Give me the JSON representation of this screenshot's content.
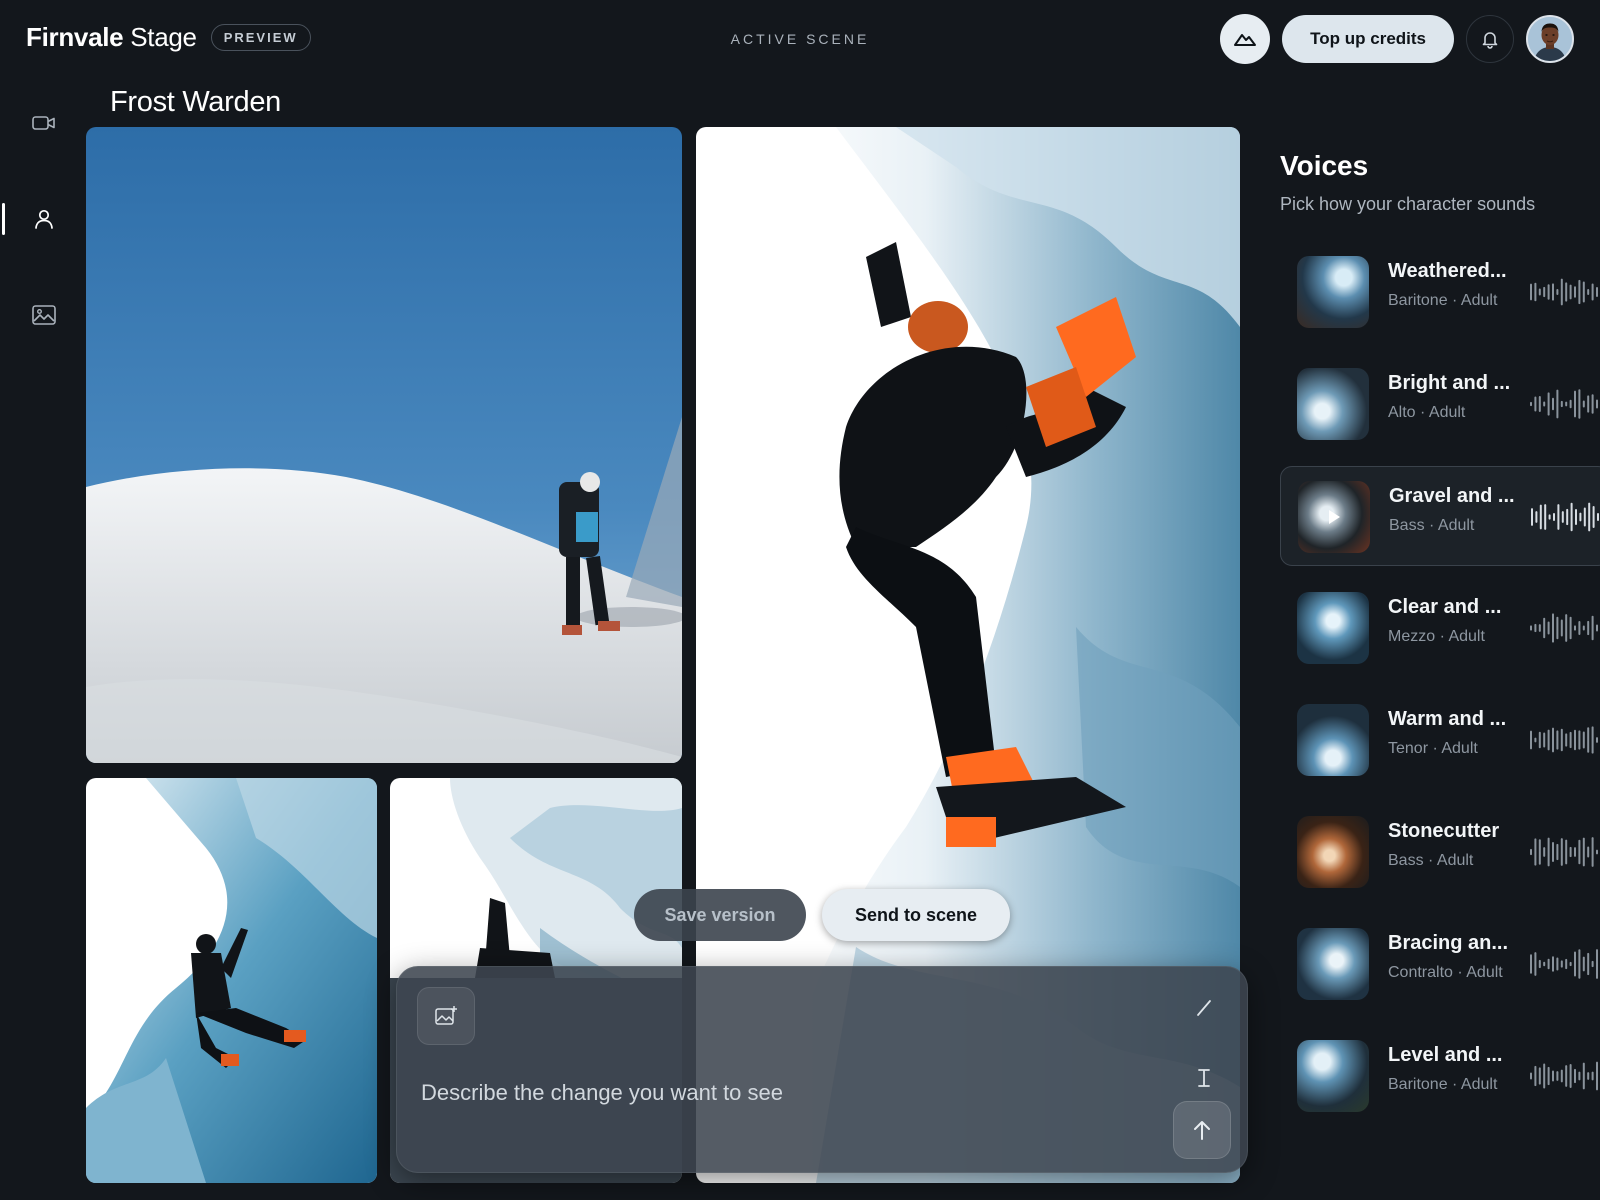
{
  "app": {
    "brand_bold": "Firnvale",
    "brand_light": "Stage",
    "preview_badge": "PREVIEW",
    "active_scene_label": "ACTIVE SCENE",
    "credits_button": "Top up credits"
  },
  "scene": {
    "title": "Frost Warden"
  },
  "actions": {
    "save_version": "Save version",
    "send_to_scene": "Send to scene"
  },
  "prompt": {
    "placeholder": "Describe the change you want to see"
  },
  "voices": {
    "title": "Voices",
    "subtitle": "Pick how your character sounds",
    "items": [
      {
        "name": "Weathered...",
        "meta": "Baritone · Adult",
        "selected": false
      },
      {
        "name": "Bright and ...",
        "meta": "Alto · Adult",
        "selected": false
      },
      {
        "name": "Gravel and ...",
        "meta": "Bass · Adult",
        "selected": true
      },
      {
        "name": "Clear and ...",
        "meta": "Mezzo · Adult",
        "selected": false
      },
      {
        "name": "Warm and ...",
        "meta": "Tenor · Adult",
        "selected": false
      },
      {
        "name": "Stonecutter",
        "meta": "Bass · Adult",
        "selected": false
      },
      {
        "name": "Bracing an...",
        "meta": "Contralto · Adult",
        "selected": false
      },
      {
        "name": "Level and ...",
        "meta": "Baritone · Adult",
        "selected": false
      }
    ]
  },
  "icons": {
    "rail": [
      "video-camera-icon",
      "person-icon",
      "image-icon"
    ],
    "top": [
      "mountain-icon",
      "bell-icon"
    ],
    "prompt": [
      "add-image-icon",
      "pen-icon",
      "text-cursor-icon",
      "arrow-up-icon"
    ]
  }
}
